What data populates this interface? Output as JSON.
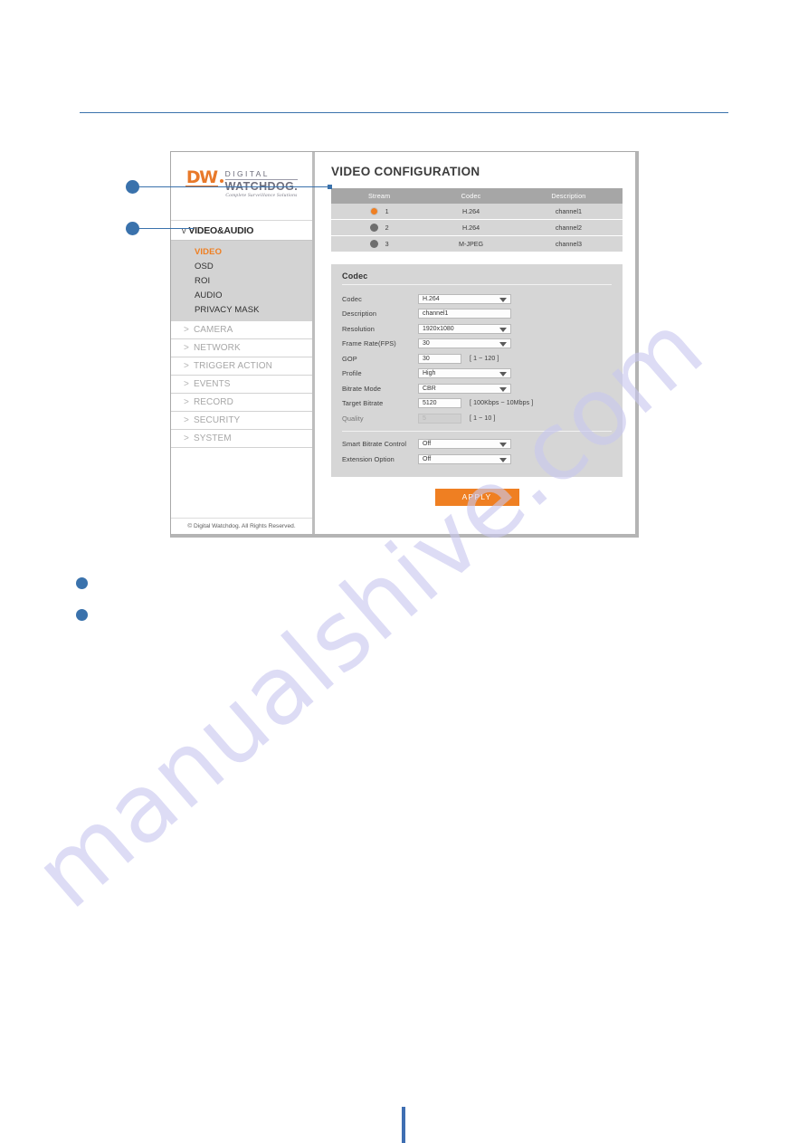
{
  "watermark": {
    "text": "manualshive.com"
  },
  "panel": {
    "sidebar": {
      "logo": {
        "mark": "DW",
        "line1": "DIGITAL",
        "line2": "WATCHDOG.",
        "tagline": "Complete Surveillance Solutions"
      },
      "section_header": {
        "chevron": "v",
        "label": "VIDEO&AUDIO"
      },
      "submenu": [
        {
          "label": "VIDEO",
          "active": true
        },
        {
          "label": "OSD",
          "active": false
        },
        {
          "label": "ROI",
          "active": false
        },
        {
          "label": "AUDIO",
          "active": false
        },
        {
          "label": "PRIVACY MASK",
          "active": false
        }
      ],
      "menu": [
        {
          "prefix": ">",
          "label": "CAMERA"
        },
        {
          "prefix": ">",
          "label": "NETWORK"
        },
        {
          "prefix": ">",
          "label": "TRIGGER ACTION"
        },
        {
          "prefix": ">",
          "label": "EVENTS"
        },
        {
          "prefix": ">",
          "label": "RECORD"
        },
        {
          "prefix": ">",
          "label": "SECURITY"
        },
        {
          "prefix": ">",
          "label": "SYSTEM"
        }
      ],
      "footer": "© Digital Watchdog. All Rights Reserved."
    },
    "content": {
      "title": "VIDEO CONFIGURATION",
      "stream_table": {
        "headers": [
          "Stream",
          "Codec",
          "Description"
        ],
        "rows": [
          {
            "stream": "1",
            "codec": "H.264",
            "description": "channel1",
            "selected": true
          },
          {
            "stream": "2",
            "codec": "H.264",
            "description": "channel2",
            "selected": false
          },
          {
            "stream": "3",
            "codec": "M-JPEG",
            "description": "channel3",
            "selected": false
          }
        ]
      },
      "codec_section": {
        "title": "Codec",
        "fields": [
          {
            "label": "Codec",
            "type": "select",
            "value": "H.264",
            "hint": ""
          },
          {
            "label": "Description",
            "type": "text",
            "value": "channel1",
            "hint": ""
          },
          {
            "label": "Resolution",
            "type": "select",
            "value": "1920x1080",
            "hint": ""
          },
          {
            "label": "Frame Rate(FPS)",
            "type": "select",
            "value": "30",
            "hint": ""
          },
          {
            "label": "GOP",
            "type": "text-small",
            "value": "30",
            "hint": "[ 1 ~ 120 ]"
          },
          {
            "label": "Profile",
            "type": "select",
            "value": "High",
            "hint": ""
          },
          {
            "label": "Bitrate Mode",
            "type": "select",
            "value": "CBR",
            "hint": ""
          },
          {
            "label": "Target Bitrate",
            "type": "text-small",
            "value": "5120",
            "hint": "[ 100Kbps ~ 10Mbps ]"
          },
          {
            "label": "Quality",
            "type": "text-small-disabled",
            "value": "5",
            "hint": "[ 1 ~ 10 ]"
          }
        ],
        "fields_lower": [
          {
            "label": "Smart Bitrate Control",
            "type": "select",
            "value": "Off",
            "hint": ""
          },
          {
            "label": "Extension Option",
            "type": "select",
            "value": "Off",
            "hint": ""
          }
        ]
      },
      "apply_label": "APPLY"
    }
  },
  "colors": {
    "accent_orange": "#ef7f22",
    "callout_blue": "#3a72ac",
    "panel_gray": "#d6d6d6",
    "table_header_gray": "#a6a6a6"
  }
}
